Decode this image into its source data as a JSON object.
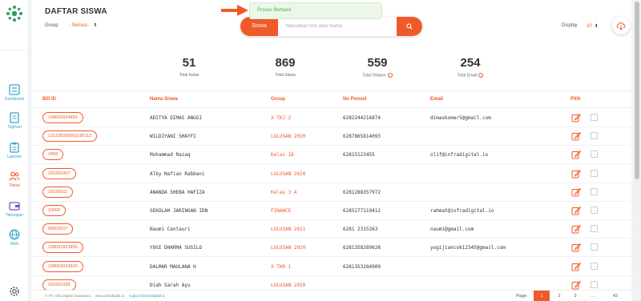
{
  "sidebar": {
    "items": [
      {
        "label": "Dashboard",
        "icon": "dashboard-icon"
      },
      {
        "label": "Tagihan",
        "icon": "invoice-icon"
      },
      {
        "label": "Laporan",
        "icon": "report-icon"
      },
      {
        "label": "Siswa",
        "icon": "users-icon"
      },
      {
        "label": "Tabungan",
        "icon": "wallet-icon"
      },
      {
        "label": "Web",
        "icon": "globe-icon"
      }
    ]
  },
  "header": {
    "title": "DAFTAR SISWA",
    "group_label": "Group",
    "group_value": "- Semua -",
    "display_label": "Display",
    "display_value": "20"
  },
  "search": {
    "tab_label": "Siswa",
    "placeholder": "Masukkan NIS atau Nama"
  },
  "toast": {
    "message": "Proses Berhasil"
  },
  "stats": [
    {
      "value": "51",
      "caption": "Total Kelas",
      "info": false
    },
    {
      "value": "869",
      "caption": "Total Siswa",
      "info": false
    },
    {
      "value": "559",
      "caption": "Total Telepon",
      "info": true
    },
    {
      "value": "254",
      "caption": "Total Email",
      "info": true
    }
  ],
  "table": {
    "headers": [
      "Bill ID",
      "Nama Siswa",
      "Group",
      "No Ponsel",
      "Email",
      "Pilih"
    ],
    "rows": [
      {
        "bill_id": "108062024893",
        "name": "ADITYA DIMAS ANGGI",
        "group": "X TKJ 2",
        "phone": "6282244216874",
        "email": "dimaskomer5@gmail.com"
      },
      {
        "bill_id": "12123529000119011​2",
        "name": "WILDIYANI SHAYFI",
        "group": "LULUSAN 2020",
        "phone": "6287865814093",
        "email": ""
      },
      {
        "bill_id": "3456",
        "name": "Mohammad Razaq",
        "group": "Kelas 1D",
        "phone": "62815123455",
        "email": "olif@infradigital.io"
      },
      {
        "bill_id": "201601057",
        "name": "Alby Nafian Rabbani",
        "group": "LULUSAN 2020",
        "phone": "",
        "email": ""
      },
      {
        "bill_id": "20192011",
        "name": "ANANDA SHEBA HAFIZA",
        "group": "Kelas 3 A",
        "phone": "6281288357972",
        "email": ""
      },
      {
        "bill_id": "10000",
        "name": "SEKOLAH JARINGAN IDN",
        "group": "FINANCE",
        "phone": "6285277119412",
        "email": "rahmat@infradigital.io"
      },
      {
        "bill_id": "60002007",
        "name": "Naumi Centauri",
        "group": "LULUSAN 2021",
        "phone": "6281 2315263",
        "email": "naumi@gmail.com"
      },
      {
        "bill_id": "108061823455",
        "name": "YOGI DHARMA SUSILO",
        "group": "LULUSAN 2020",
        "phone": "6281358289628",
        "email": "yogijiancok12345@gmail.com"
      },
      {
        "bill_id": "108062024920",
        "name": "DALMAR MAULANA H",
        "group": "X TKR 1",
        "phone": "6281353284909",
        "email": ""
      },
      {
        "bill_id": "201601038",
        "name": "Diah Sarah Ayu",
        "group": "LULUSAN 2020",
        "phone": "",
        "email": ""
      }
    ]
  },
  "footer": {
    "copyright": "© PT. Infra Digital Nusantara",
    "website": "www.infradigital.io",
    "support": "support@infradigital.io",
    "page_label": "Page:",
    "pages": [
      "1",
      "2",
      "3",
      "...",
      "42"
    ],
    "current_page": "1"
  },
  "colors": {
    "accent": "#ef5a28",
    "nav": "#3aa3c6",
    "success": "#4caf50"
  }
}
